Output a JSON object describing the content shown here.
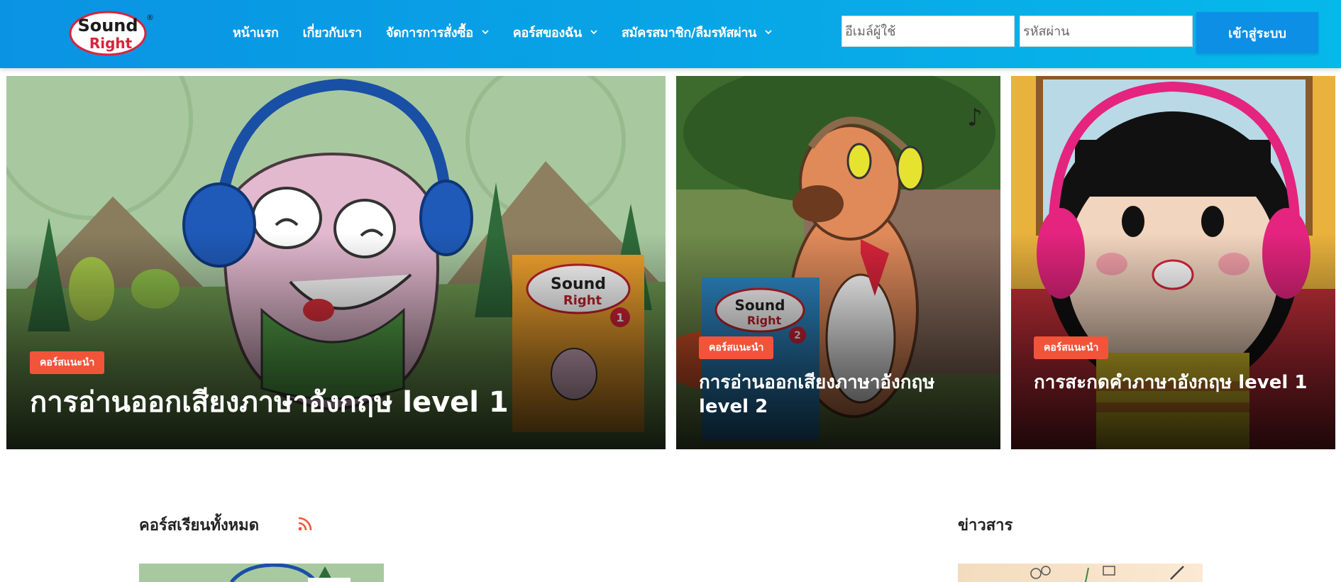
{
  "header": {
    "logo": {
      "brand_top": "Sound",
      "brand_bottom": "Right",
      "mark": "®"
    },
    "nav": [
      {
        "label": "หน้าแรก",
        "has_dropdown": false
      },
      {
        "label": "เกี่ยวกับเรา",
        "has_dropdown": false
      },
      {
        "label": "จัดการการสั่งซื้อ",
        "has_dropdown": true
      },
      {
        "label": "คอร์สของฉัน",
        "has_dropdown": true
      },
      {
        "label": "สมัครสมาชิก/ลืมรหัสผ่าน",
        "has_dropdown": true
      }
    ],
    "login": {
      "email_placeholder": "อีเมล์ผู้ใช้",
      "password_placeholder": "รหัสผ่าน",
      "button_label": "เข้าสู่ระบบ"
    }
  },
  "featured": [
    {
      "badge": "คอร์สแนะนำ",
      "title": "การอ่านออกเสียงภาษาอังกฤษ level 1",
      "book_number": "1"
    },
    {
      "badge": "คอร์สแนะนำ",
      "title": "การอ่านออกเสียงภาษาอังกฤษ level 2",
      "book_number": "2"
    },
    {
      "badge": "คอร์สแนะนำ",
      "title": "การสะกดคำภาษาอังกฤษ level 1"
    }
  ],
  "sections": {
    "courses_title": "คอร์สเรียนทั้งหมด",
    "news_title": "ข่าวสาร"
  },
  "colors": {
    "header_start": "#0a93e3",
    "header_end": "#06b9ea",
    "badge": "#f2543a",
    "rss": "#f2543a"
  },
  "icons": [
    "logo",
    "chevron-down-icon",
    "rss-icon"
  ]
}
